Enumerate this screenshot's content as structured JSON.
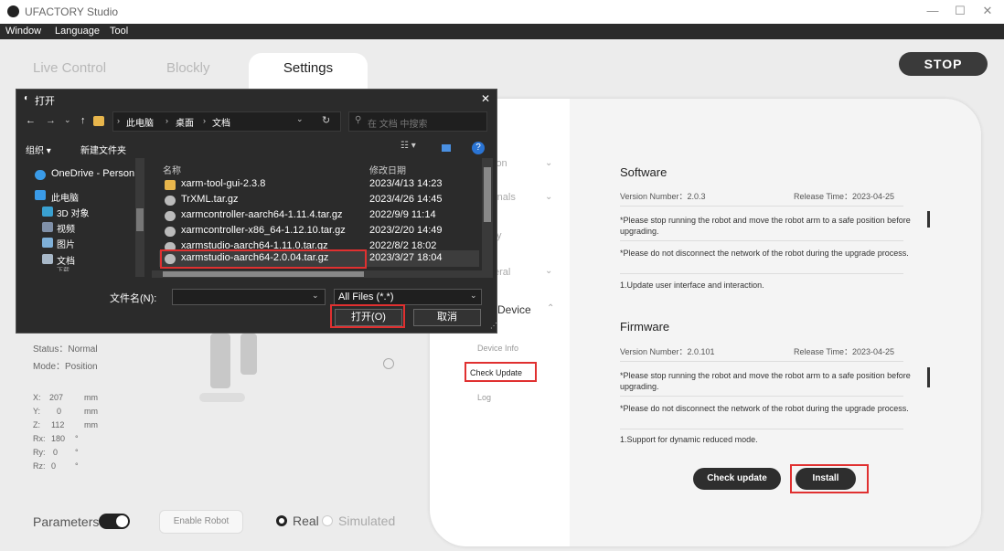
{
  "window": {
    "title": "UFACTORY Studio",
    "minimize": "—",
    "maximize": "☐",
    "close": "✕"
  },
  "menu": [
    "Window",
    "Language",
    "Tool"
  ],
  "tabs": {
    "live": "Live Control",
    "blockly": "Blockly",
    "settings": "Settings"
  },
  "stop_label": "STOP",
  "settings_nav": {
    "general_top": "ion",
    "externals": "rnals",
    "safety": "ty",
    "general": "eral",
    "device": "Device",
    "device_info": "Device Info",
    "check_update": "Check Update",
    "log": "Log"
  },
  "software": {
    "title": "Software",
    "version": "Version Number：2.0.3",
    "release": "Release Time：2023-04-25",
    "notes": [
      "*Please stop running the robot and move the robot arm to a safe position before upgrading.",
      "*Please do not disconnect the network of the robot during the upgrade process.",
      "1.Update user interface and interaction."
    ]
  },
  "firmware": {
    "title": "Firmware",
    "version": "Version Number：2.0.101",
    "release": "Release Time：2023-04-25",
    "notes": [
      "*Please stop running the robot and move the robot arm to a safe position before upgrading.",
      "*Please do not disconnect the network of the robot during the upgrade process.",
      "1.Support for dynamic reduced mode."
    ]
  },
  "buttons": {
    "check_update": "Check update",
    "install": "Install"
  },
  "status": {
    "status": "Status：Normal",
    "mode": "Mode：Position"
  },
  "coords": [
    {
      "axis": "X:",
      "value": "207",
      "unit": "mm"
    },
    {
      "axis": "Y:",
      "value": "0",
      "unit": "mm"
    },
    {
      "axis": "Z:",
      "value": "112",
      "unit": "mm"
    },
    {
      "axis": "Rx:",
      "value": "180",
      "unit": "°"
    },
    {
      "axis": "Ry:",
      "value": "0",
      "unit": "°"
    },
    {
      "axis": "Rz:",
      "value": "0",
      "unit": "°"
    }
  ],
  "bottom": {
    "parameters": "Parameters",
    "enable_robot": "Enable Robot",
    "real": "Real",
    "simulated": "Simulated"
  },
  "dialog": {
    "title": "打开",
    "breadcrumb": [
      "此电脑",
      "桌面",
      "文档"
    ],
    "search_placeholder": "在 文档 中搜索",
    "organize": "组织 ▾",
    "new_folder": "新建文件夹",
    "col_name": "名称",
    "col_date": "修改日期",
    "tree": [
      "OneDrive - Person",
      "此电脑",
      "3D 对象",
      "视频",
      "图片",
      "文档",
      "下载"
    ],
    "files": [
      {
        "name": "xarm-tool-gui-2.3.8",
        "date": "2023/4/13 14:23"
      },
      {
        "name": "TrXML.tar.gz",
        "date": "2023/4/26 14:45"
      },
      {
        "name": "xarmcontroller-aarch64-1.11.4.tar.gz",
        "date": "2022/9/9 11:14"
      },
      {
        "name": "xarmcontroller-x86_64-1.12.10.tar.gz",
        "date": "2023/2/20 14:49"
      },
      {
        "name": "xarmstudio-aarch64-1.11.0.tar.gz",
        "date": "2022/8/2 18:02"
      },
      {
        "name": "xarmstudio-aarch64-2.0.04.tar.gz",
        "date": "2023/3/27 18:04"
      }
    ],
    "filename_label": "文件名(N):",
    "filter": "All Files (*.*)",
    "open": "打开(O)",
    "cancel": "取消"
  },
  "colors": {
    "highlight": "#e03030",
    "dialog_bg": "#2b2b2b",
    "stop_bg": "#3a3a3a"
  }
}
